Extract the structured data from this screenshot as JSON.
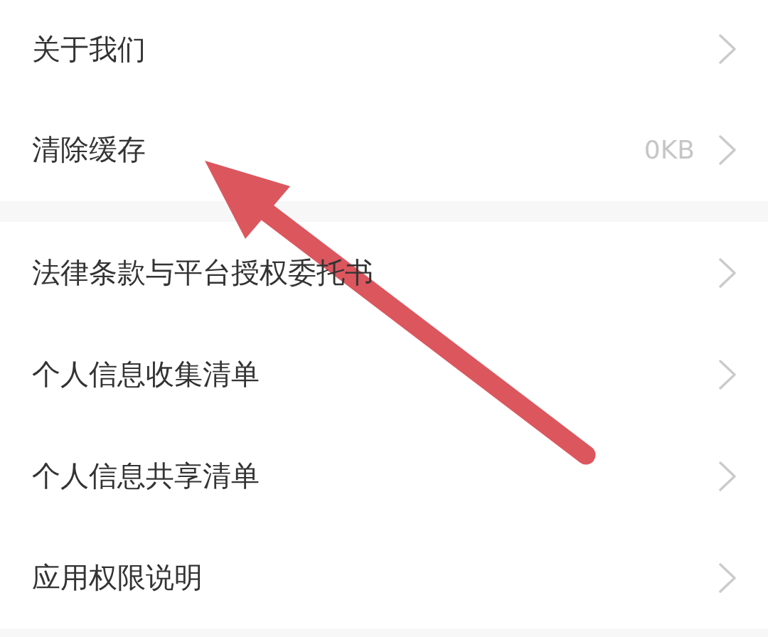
{
  "sections": [
    {
      "items": [
        {
          "label": "关于我们"
        },
        {
          "label": "清除缓存",
          "value": "0KB"
        }
      ]
    },
    {
      "items": [
        {
          "label": "法律条款与平台授权委托书"
        },
        {
          "label": "个人信息收集清单"
        },
        {
          "label": "个人信息共享清单"
        },
        {
          "label": "应用权限说明"
        }
      ]
    }
  ]
}
